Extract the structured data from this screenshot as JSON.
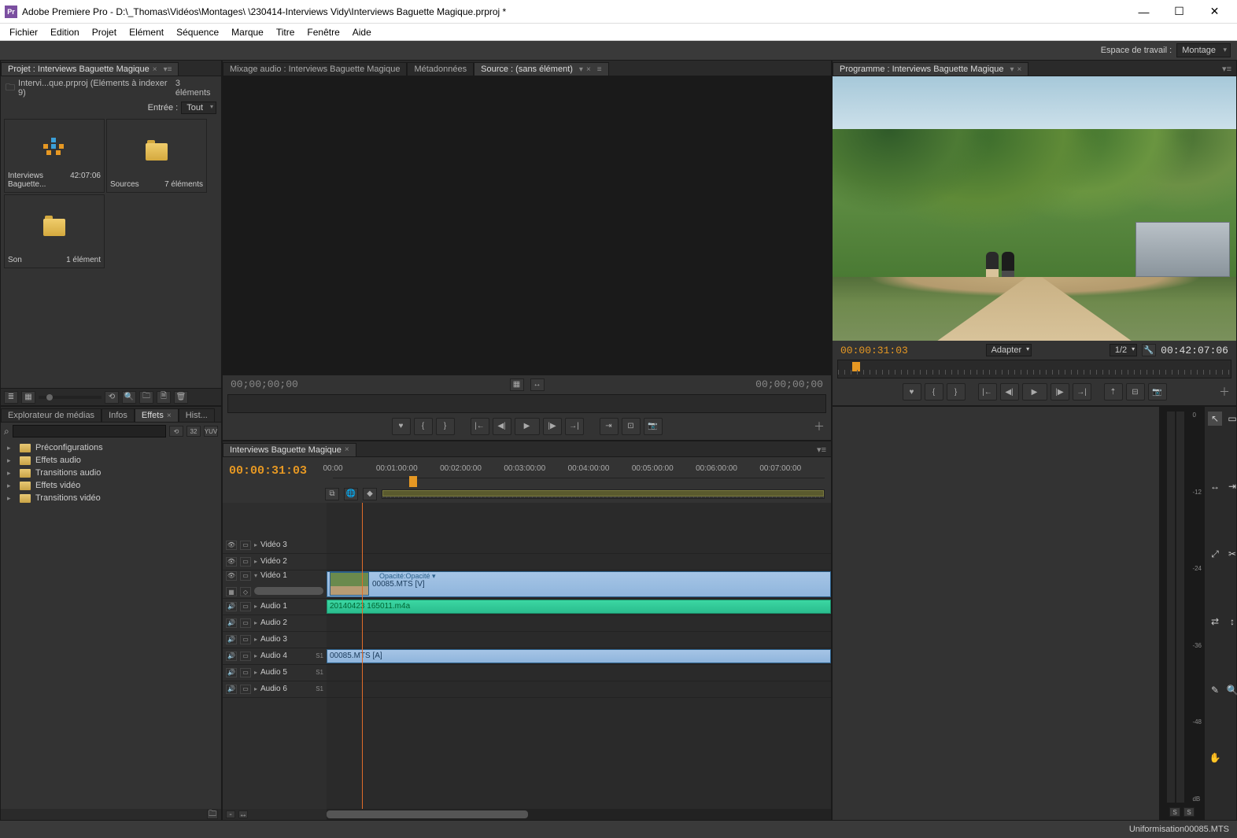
{
  "title": "Adobe Premiere Pro - D:\\_Thomas\\Vidéos\\Montages\\                         \\230414-Interviews Vidy\\Interviews Baguette Magique.prproj *",
  "menus": [
    "Fichier",
    "Edition",
    "Projet",
    "Elément",
    "Séquence",
    "Marque",
    "Titre",
    "Fenêtre",
    "Aide"
  ],
  "workspace": {
    "label": "Espace de travail :",
    "value": "Montage"
  },
  "project": {
    "tab": "Projet : Interviews Baguette Magique",
    "breadcrumb": "Intervi...que.prproj (Eléments à indexer 9)",
    "count": "3 éléments",
    "filter_label": "Entrée :",
    "filter_value": "Tout",
    "bins": [
      {
        "type": "seq",
        "name": "Interviews Baguette...",
        "meta": "42:07:06"
      },
      {
        "type": "folder",
        "name": "Sources",
        "meta": "7 éléments"
      },
      {
        "type": "folder",
        "name": "Son",
        "meta": "1 élément"
      }
    ]
  },
  "source": {
    "tabs": [
      "Mixage audio : Interviews Baguette Magique",
      "Métadonnées",
      "Source : (sans élément)"
    ],
    "active": 2,
    "tc_in": "00;00;00;00",
    "tc_out": "00;00;00;00"
  },
  "program": {
    "tab": "Programme : Interviews Baguette Magique",
    "tc_in": "00:00:31:03",
    "fit": "Adapter",
    "res": "1/2",
    "tc_out": "00:42:07:06"
  },
  "effects": {
    "tabs": [
      "Explorateur de médias",
      "Infos",
      "Effets",
      "Hist..."
    ],
    "active": 2,
    "chips": [
      "⟲",
      "32",
      "YUV"
    ],
    "items": [
      "Préconfigurations",
      "Effets audio",
      "Transitions audio",
      "Effets vidéo",
      "Transitions vidéo"
    ]
  },
  "timeline": {
    "tab": "Interviews Baguette Magique",
    "tc": "00:00:31:03",
    "ruler": [
      "00:00",
      "00:01:00:00",
      "00:02:00:00",
      "00:03:00:00",
      "00:04:00:00",
      "00:05:00:00",
      "00:06:00:00",
      "00:07:00:00"
    ],
    "video_tracks": [
      "Vidéo 3",
      "Vidéo 2",
      "Vidéo 1"
    ],
    "audio_tracks": [
      "Audio 1",
      "Audio 2",
      "Audio 3",
      "Audio 4",
      "Audio 5",
      "Audio 6"
    ],
    "audio_flags": {
      "Audio 4": "S1",
      "Audio 5": "S1",
      "Audio 6": "S1"
    },
    "clips": {
      "v1": {
        "name": "00085.MTS [V]",
        "fx": "Opacité:Opacité ▾"
      },
      "a1": {
        "name": "20140423 165011.m4a"
      },
      "a4": {
        "name": "00085.MTS [A]"
      }
    }
  },
  "meters": {
    "scale": [
      "0",
      "-12",
      "-24",
      "-36",
      "-48",
      "dB"
    ],
    "chips": [
      "S",
      "S"
    ]
  },
  "tools": [
    "↖",
    "▭",
    "↔",
    "⇥",
    "⤢",
    "✂",
    "⇄",
    "↕",
    "✎",
    "🔍",
    "✋",
    " "
  ],
  "statusbar": "Uniformisation00085.MTS"
}
